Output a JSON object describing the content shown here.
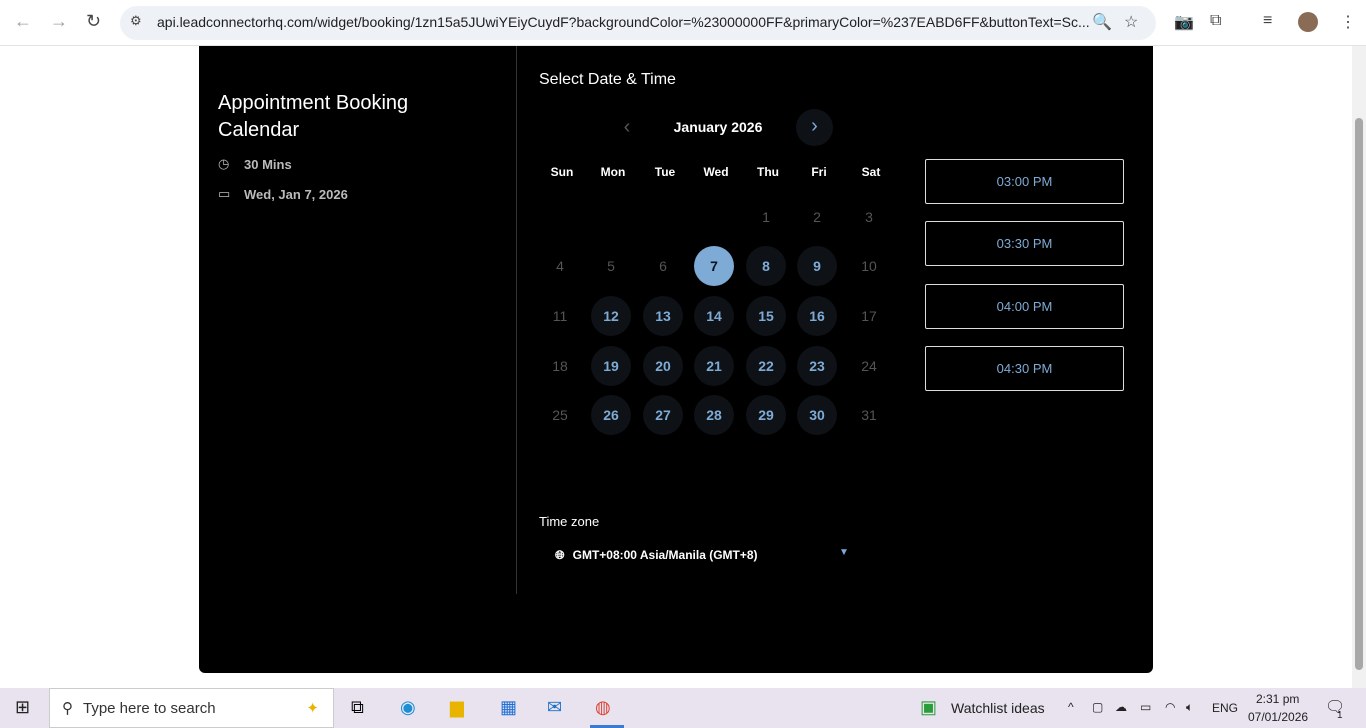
{
  "browser": {
    "url": "api.leadconnectorhq.com/widget/booking/1zn15a5JUwiYEiyCuydF?backgroundColor=%23000000FF&primaryColor=%237EABD6FF&buttonText=Sc..."
  },
  "booking": {
    "title": "Appointment Booking Calendar",
    "duration": "30 Mins",
    "date": "Wed, Jan 7, 2026",
    "heading": "Select Date & Time",
    "month": "January 2026",
    "weekdays": [
      "Sun",
      "Mon",
      "Tue",
      "Wed",
      "Thu",
      "Fri",
      "Sat"
    ],
    "first_weekday": 4,
    "days_in_month": 31,
    "available_days": [
      8,
      9,
      12,
      13,
      14,
      15,
      16,
      19,
      20,
      21,
      22,
      23,
      26,
      27,
      28,
      29,
      30
    ],
    "selected_day": 7,
    "slots": [
      "03:00 PM",
      "03:30 PM",
      "04:00 PM",
      "04:30 PM"
    ],
    "timezone_label": "Time zone",
    "timezone": "GMT+08:00 Asia/Manila (GMT+8)",
    "primary_color": "#7EABD6"
  },
  "taskbar": {
    "search_placeholder": "Type here to search",
    "widget": "Watchlist ideas",
    "lang": "ENG",
    "time": "2:31 pm",
    "date": "07/01/2026",
    "notif_count": "1"
  }
}
